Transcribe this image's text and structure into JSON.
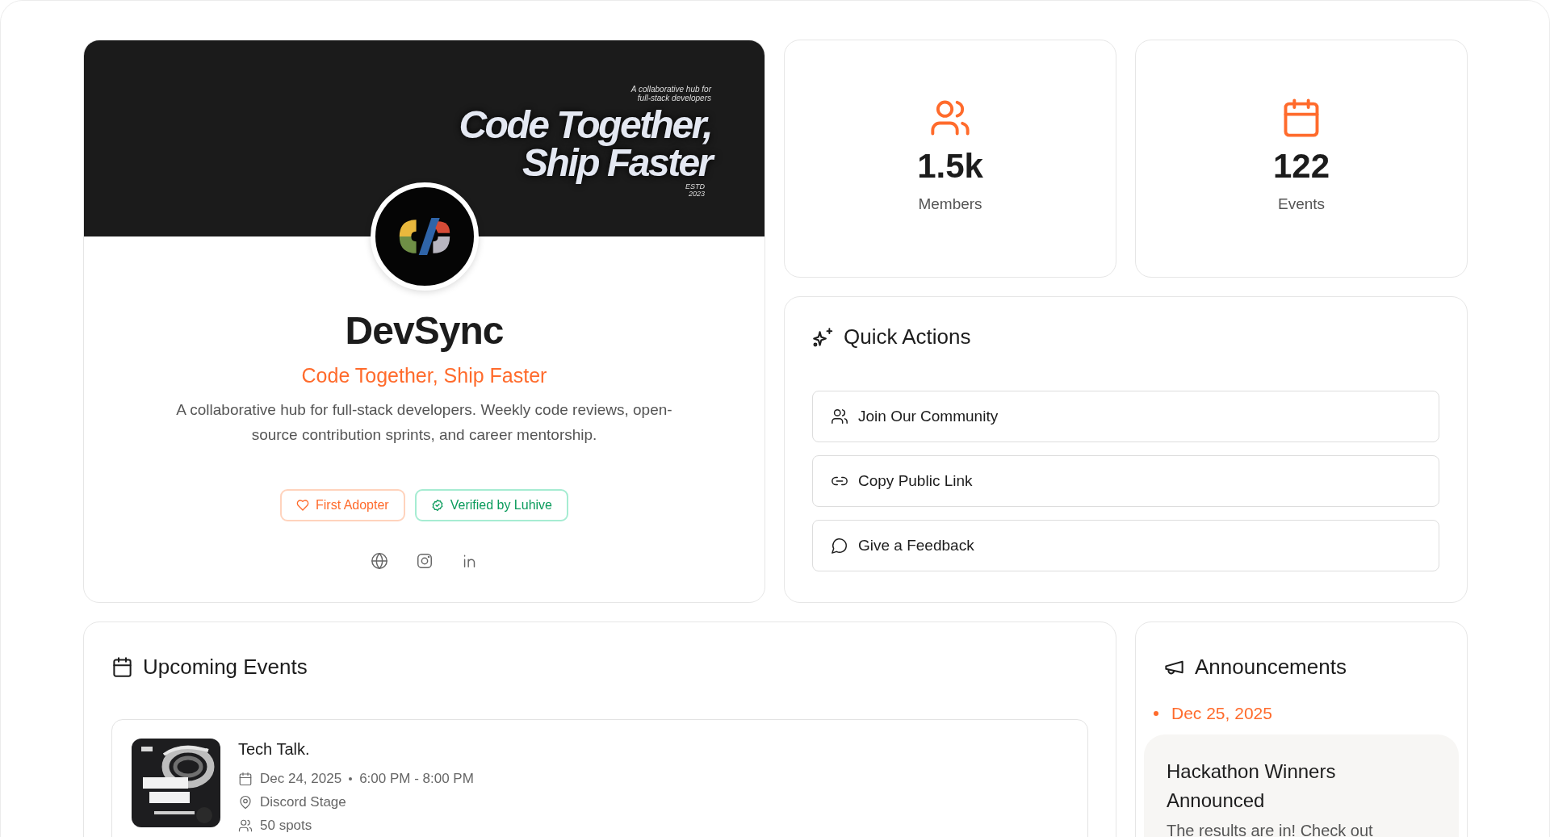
{
  "profile": {
    "banner": {
      "caption": "A collaborative hub for full-stack developers",
      "headline": "Code Together, Ship Faster",
      "established": "ESTD 2023"
    },
    "name": "DevSync",
    "tagline": "Code Together, Ship Faster",
    "description": "A collaborative hub for full-stack developers. Weekly code reviews, open-source contribution sprints, and career mentorship.",
    "badges": [
      {
        "label": "First Adopter",
        "kind": "heart"
      },
      {
        "label": "Verified by Luhive",
        "kind": "verified"
      }
    ],
    "social_links": [
      {
        "kind": "website"
      },
      {
        "kind": "instagram"
      },
      {
        "kind": "linkedin"
      }
    ]
  },
  "stats": [
    {
      "value": "1.5k",
      "label": "Members",
      "kind": "members"
    },
    {
      "value": "122",
      "label": "Events",
      "kind": "events"
    }
  ],
  "quick_actions": {
    "title": "Quick Actions",
    "items": [
      {
        "label": "Join Our Community",
        "kind": "community"
      },
      {
        "label": "Copy Public Link",
        "kind": "link"
      },
      {
        "label": "Give a Feedback",
        "kind": "feedback"
      }
    ]
  },
  "upcoming_events": {
    "title": "Upcoming Events",
    "events": [
      {
        "title": "Tech Talk.",
        "date": "Dec 24, 2025",
        "time": "6:00 PM - 8:00 PM",
        "location": "Discord Stage",
        "spots": "50 spots"
      }
    ]
  },
  "announcements": {
    "title": "Announcements",
    "items": [
      {
        "date": "Dec 25, 2025",
        "title": "Hackathon Winners Announced",
        "body": "The results are in! Check out"
      }
    ]
  }
}
